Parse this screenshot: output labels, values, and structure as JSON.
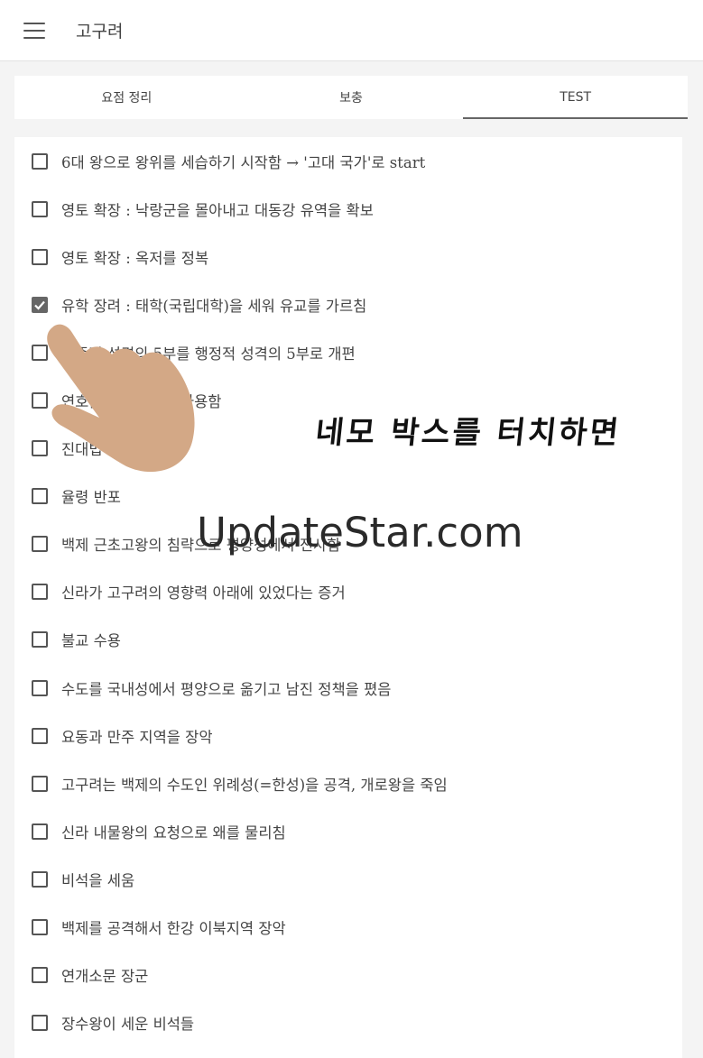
{
  "header": {
    "title": "고구려"
  },
  "tabs": [
    {
      "label": "요점 정리"
    },
    {
      "label": "보충"
    },
    {
      "label": "TEST"
    }
  ],
  "items": [
    {
      "text": "6대 왕으로 왕위를 세습하기 시작함 → '고대 국가'로 start",
      "checked": false
    },
    {
      "text": "영토 확장 : 낙랑군을 몰아내고 대동강 유역을 확보",
      "checked": false
    },
    {
      "text": "영토 확장 : 옥저를 정복",
      "checked": false
    },
    {
      "text": "유학 장려 : 태학(국립대학)을 세워 유교를 가르침",
      "checked": true
    },
    {
      "text": "부족적 성격의 5부를 행정적 성격의 5부로 개편",
      "checked": false
    },
    {
      "text": "연호를 독자적으로 사용함",
      "checked": false
    },
    {
      "text": "진대법",
      "checked": false
    },
    {
      "text": "율령 반포",
      "checked": false
    },
    {
      "text": "백제 근초고왕의 침략으로 평양성에서 전사함",
      "checked": false
    },
    {
      "text": "신라가 고구려의 영향력 아래에 있었다는 증거",
      "checked": false
    },
    {
      "text": "불교 수용",
      "checked": false
    },
    {
      "text": "수도를 국내성에서 평양으로 옮기고 남진 정책을 폈음",
      "checked": false
    },
    {
      "text": "요동과 만주 지역을 장악",
      "checked": false
    },
    {
      "text": "고구려는 백제의 수도인 위례성(=한성)을 공격, 개로왕을 죽임",
      "checked": false
    },
    {
      "text": "신라 내물왕의 요청으로 왜를 물리침",
      "checked": false
    },
    {
      "text": "비석을 세움",
      "checked": false
    },
    {
      "text": "백제를 공격해서 한강 이북지역 장악",
      "checked": false
    },
    {
      "text": "연개소문 장군",
      "checked": false
    },
    {
      "text": "장수왕이 세운 비석들",
      "checked": false
    }
  ],
  "overlay": {
    "caption": "네모 박스를 터치하면",
    "watermark": "UpdateStar.com"
  },
  "colors": {
    "hand": "#d3a886",
    "checkbox": "#555555"
  }
}
